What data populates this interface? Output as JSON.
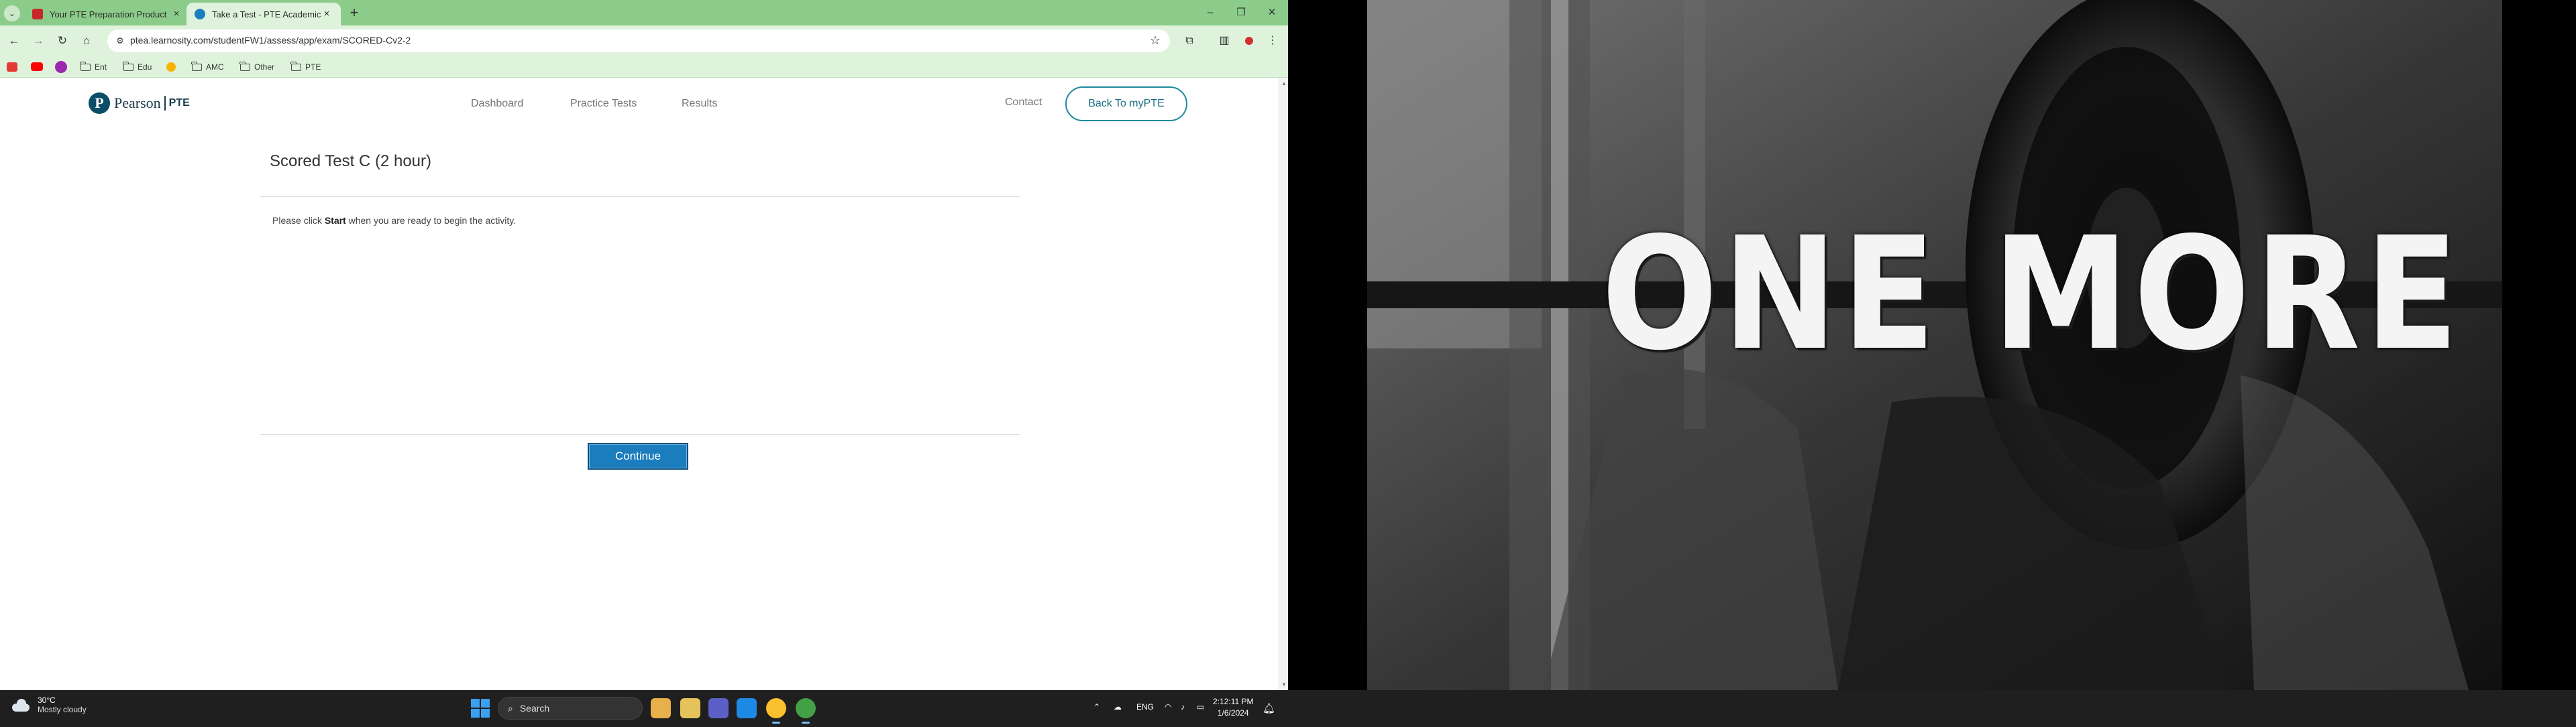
{
  "browser": {
    "tabs": [
      {
        "title": "Your PTE Preparation Product",
        "favicon_color": "#c62828"
      },
      {
        "title": "Take a Test - PTE Academic",
        "favicon_color": "#1b7dbd",
        "active": true
      }
    ],
    "url": "ptea.learnosity.com/studentFW1/assess/app/exam/SCORED-Cv2-2",
    "bookmarks": [
      "Ent",
      "Edu",
      "AMC",
      "Other",
      "PTE"
    ]
  },
  "site": {
    "logo_brand": "Pearson",
    "logo_product": "PTE",
    "nav": [
      "Dashboard",
      "Practice Tests",
      "Results"
    ],
    "contact": "Contact",
    "back_button": "Back To myPTE"
  },
  "test": {
    "title": "Scored Test C (2 hour)",
    "instruction_pre": "Please click ",
    "instruction_bold": "Start",
    "instruction_post": " when you are ready to begin the activity.",
    "continue_button": "Continue"
  },
  "wallpaper": {
    "text": "ONE MORE"
  },
  "taskbar": {
    "weather_temp": "30°C",
    "weather_condition": "Mostly cloudy",
    "search_placeholder": "Search",
    "language": "ENG",
    "time": "2:12:11 PM",
    "date": "1/6/2024"
  }
}
